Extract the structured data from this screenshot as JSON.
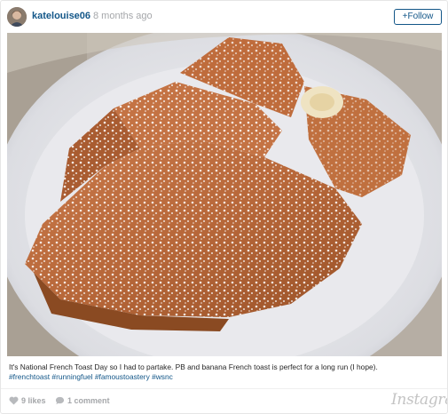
{
  "post": {
    "username": "katelouise06",
    "separator": "·",
    "time_ago": "8 months ago",
    "follow_label": "+Follow",
    "caption_text": "It's National French Toast Day so I had to partake. PB and banana French toast is perfect for a long run (I hope).",
    "hashtags": "#frenchtoast #runningfuel #famoustoastery #wsnc",
    "likes_label": "9 likes",
    "comments_label": "1 comment",
    "brand_label": "Instagram"
  },
  "icons": {
    "like": "heart-icon",
    "comment": "speech-bubble-icon"
  },
  "colors": {
    "link": "#125688",
    "meta": "#a5a7aa",
    "border": "#e6e6e6"
  }
}
